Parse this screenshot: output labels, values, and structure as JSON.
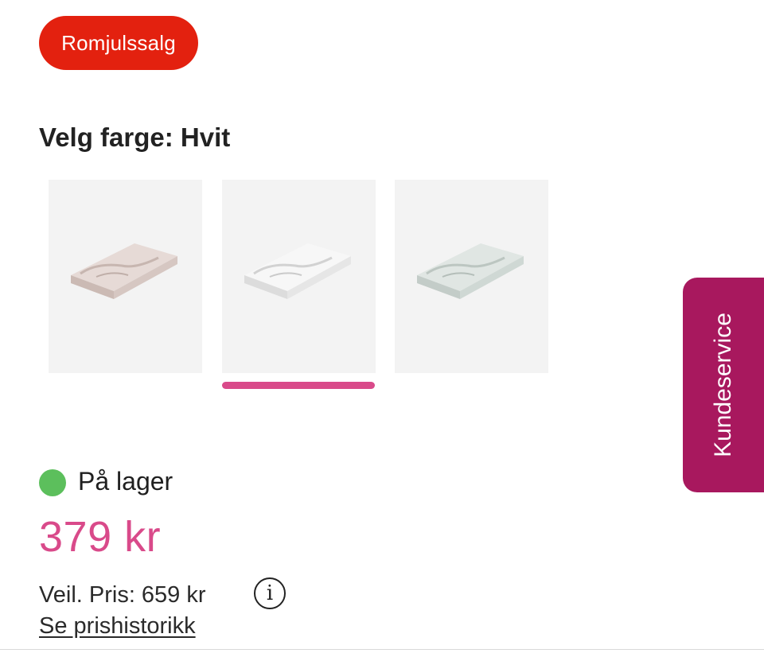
{
  "promo_badge": {
    "label": "Romjulssalg",
    "color": "#e3210f"
  },
  "color_selector": {
    "title": "Velg farge: Hvit",
    "selected_index": 1,
    "swatches": [
      {
        "name": "Rosa",
        "product_color": "#d8c9c4"
      },
      {
        "name": "Hvit",
        "product_color": "#ececec"
      },
      {
        "name": "Grønn",
        "product_color": "#cfd8d4"
      }
    ],
    "selected_indicator_color": "#d94a8a"
  },
  "stock": {
    "label": "På lager",
    "indicator_color": "#5cbf5c"
  },
  "price": {
    "current": "379 kr",
    "current_color": "#d94a8a",
    "recommended": "Veil. Pris: 659 kr",
    "info_icon": "info-icon",
    "history_link": "Se prishistorikk"
  },
  "customer_service": {
    "label": "Kundeservice",
    "color": "#a8185e"
  }
}
